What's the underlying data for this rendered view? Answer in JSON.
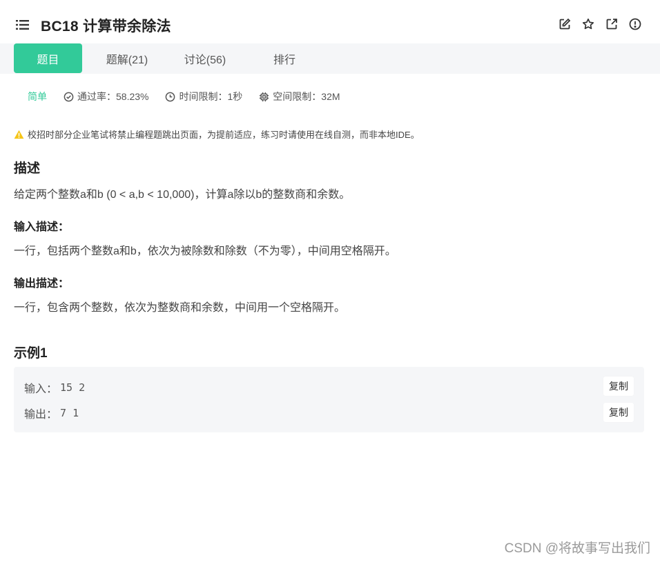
{
  "header": {
    "title": "BC18  计算带余除法",
    "actions": [
      "edit-icon",
      "star-icon",
      "external-link-icon",
      "alert-icon"
    ]
  },
  "tabs": [
    {
      "label": "题目",
      "active": true
    },
    {
      "label": "题解(21)",
      "active": false
    },
    {
      "label": "讨论(56)",
      "active": false
    },
    {
      "label": "排行",
      "active": false
    }
  ],
  "meta": {
    "difficulty": "简单",
    "pass_rate": "通过率：58.23%",
    "time_limit": "时间限制：1秒",
    "space_limit": "空间限制：32M"
  },
  "notice": "校招时部分企业笔试将禁止编程题跳出页面，为提前适应，练习时请使用在线自测，而非本地IDE。",
  "description": {
    "title": "描述",
    "text": "给定两个整数a和b (0 < a,b < 10,000)，计算a除以b的整数商和余数。"
  },
  "input_desc": {
    "title": "输入描述：",
    "text": "一行，包括两个整数a和b，依次为被除数和除数（不为零），中间用空格隔开。"
  },
  "output_desc": {
    "title": "输出描述：",
    "text": "一行，包含两个整数，依次为整数商和余数，中间用一个空格隔开。"
  },
  "example": {
    "title": "示例1",
    "input_label": "输入：",
    "input_value": "15 2",
    "output_label": "输出：",
    "output_value": "7 1",
    "copy_label": "复制"
  },
  "watermark": "CSDN @将故事写出我们",
  "colors": {
    "accent": "#32ca99",
    "tabbar_bg": "#f5f6f8",
    "warning": "#f5c518"
  }
}
